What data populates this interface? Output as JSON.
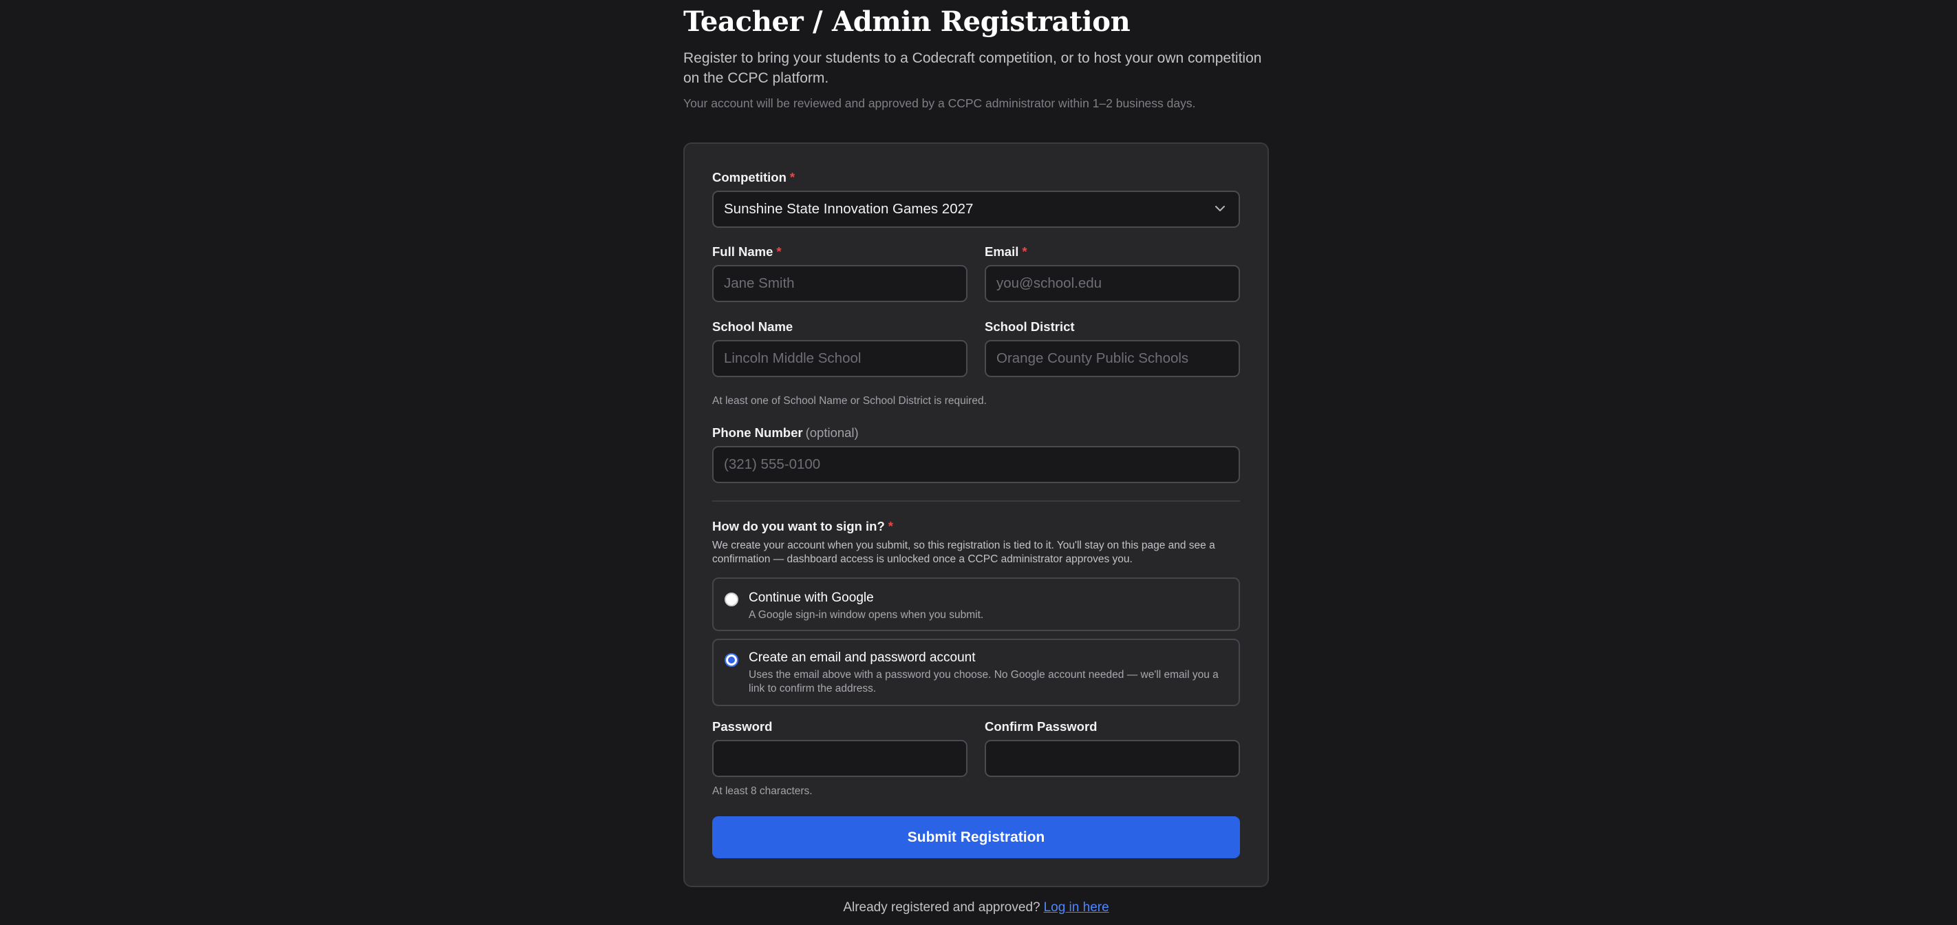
{
  "header": {
    "title": "Teacher / Admin Registration",
    "intro": "Register to bring your students to a Codecraft competition, or to host your own competition on the CCPC platform.",
    "note": "Your account will be reviewed and approved by a CCPC administrator within 1–2 business days."
  },
  "form": {
    "required_mark": "*",
    "competition": {
      "label": "Competition",
      "value": "Sunshine State Innovation Games 2027"
    },
    "full_name": {
      "label": "Full Name",
      "placeholder": "Jane Smith"
    },
    "email": {
      "label": "Email",
      "placeholder": "you@school.edu"
    },
    "school_name": {
      "label": "School Name",
      "placeholder": "Lincoln Middle School"
    },
    "school_district": {
      "label": "School District",
      "placeholder": "Orange County Public Schools"
    },
    "school_help": "At least one of School Name or School District is required.",
    "phone": {
      "label": "Phone Number",
      "optional": "(optional)",
      "placeholder": "(321) 555-0100"
    },
    "signin": {
      "question": "How do you want to sign in?",
      "description": "We create your account when you submit, so this registration is tied to it. You'll stay on this page and see a confirmation — dashboard access is unlocked once a CCPC administrator approves you.",
      "options": [
        {
          "title": "Continue with Google",
          "description": "A Google sign-in window opens when you submit.",
          "selected": false
        },
        {
          "title": "Create an email and password account",
          "description": "Uses the email above with a password you choose. No Google account needed — we'll email you a link to confirm the address.",
          "selected": true
        }
      ]
    },
    "password": {
      "label": "Password",
      "value": ""
    },
    "confirm_password": {
      "label": "Confirm Password",
      "value": ""
    },
    "password_help": "At least 8 characters.",
    "submit_label": "Submit Registration"
  },
  "footer": {
    "text": "Already registered and approved?",
    "link_label": "Log in here"
  },
  "colors": {
    "background": "#18181a",
    "card": "#27272a",
    "accent": "#2a63e6",
    "required": "#ef4444",
    "link": "#4f86ff"
  },
  "icons": {
    "competition_select": "chevron-down-icon"
  }
}
